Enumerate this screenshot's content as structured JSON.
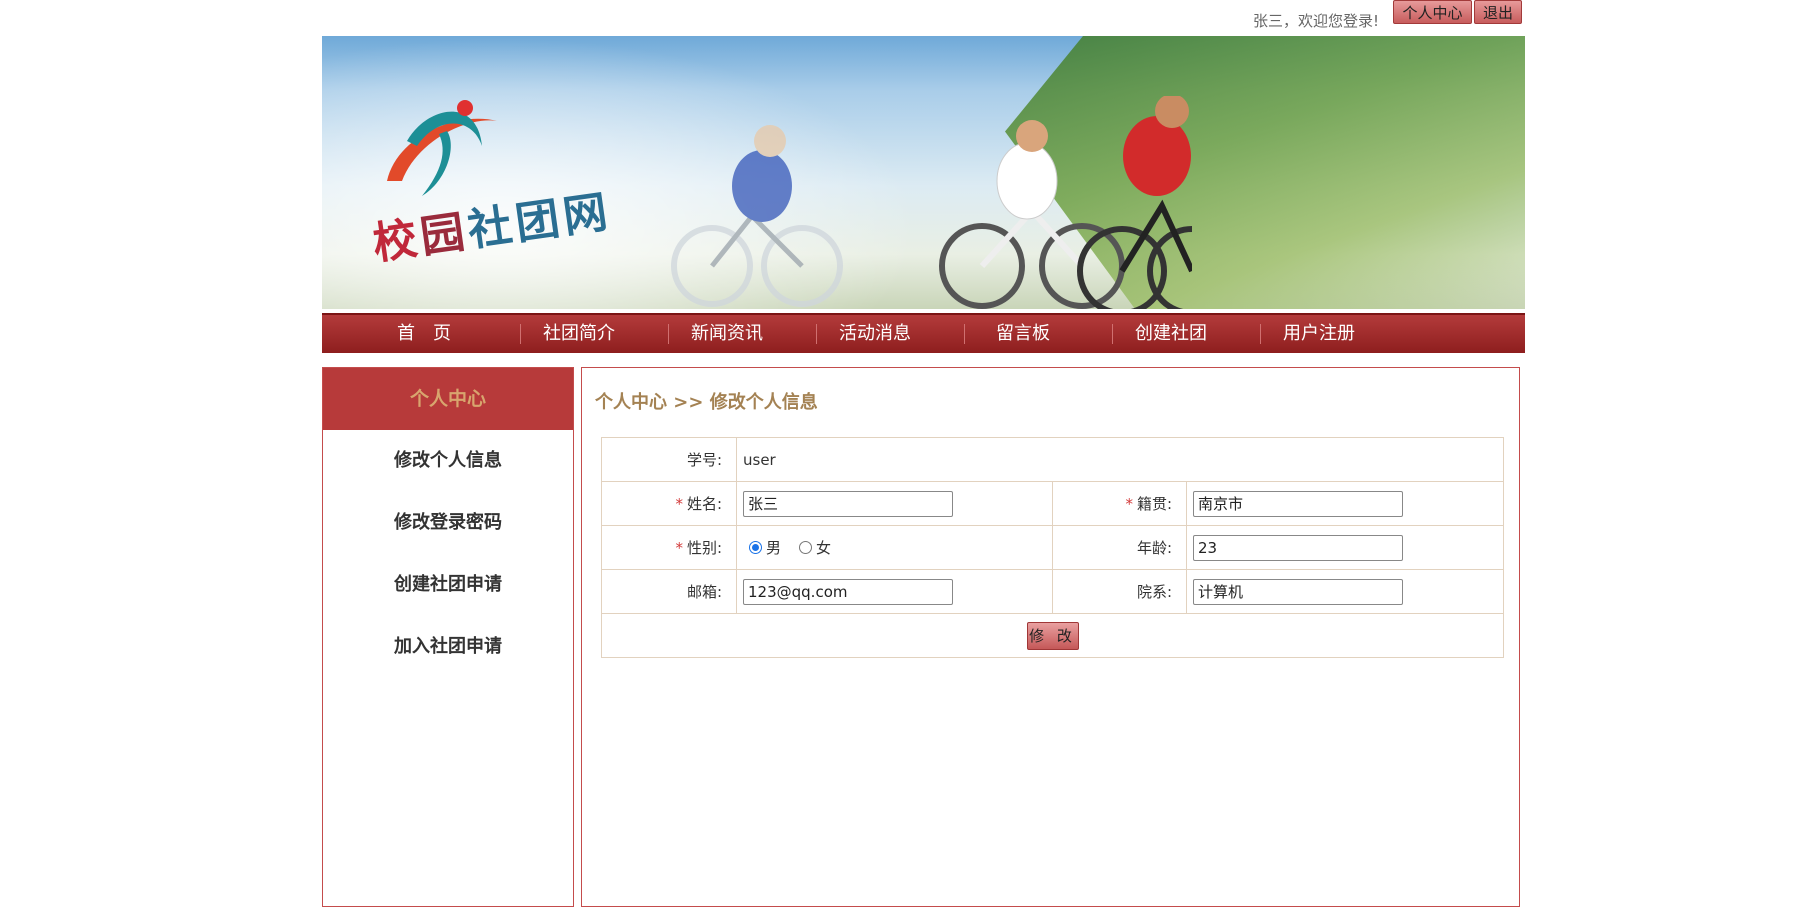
{
  "topbar": {
    "welcome": "张三，欢迎您登录!",
    "personal_center": "个人中心",
    "logout": "退出"
  },
  "banner": {
    "logo_text": [
      "校",
      "园",
      "社",
      "团",
      "网"
    ]
  },
  "nav": {
    "items": [
      "首　页",
      "社团简介",
      "新闻资讯",
      "活动消息",
      "留言板",
      "创建社团",
      "用户注册"
    ]
  },
  "sidebar": {
    "title": "个人中心",
    "items": [
      "修改个人信息",
      "修改登录密码",
      "创建社团申请",
      "加入社团申请"
    ]
  },
  "main": {
    "breadcrumb": "个人中心 >> 修改个人信息",
    "form": {
      "student_id_label": "学号:",
      "student_id_value": "user",
      "name_label": "姓名:",
      "name_value": "张三",
      "hometown_label": "籍贯:",
      "hometown_value": "南京市",
      "gender_label": "性别:",
      "gender_male": "男",
      "gender_female": "女",
      "gender_selected": "男",
      "age_label": "年龄:",
      "age_value": "23",
      "email_label": "邮箱:",
      "email_value": "123@qq.com",
      "department_label": "院系:",
      "department_value": "计算机",
      "submit_label": "修 改"
    }
  },
  "colors": {
    "nav_red": "#9e2a2a",
    "sidebar_title_bg": "#b73a3a",
    "accent_gold": "#a48253",
    "radio_blue": "#1a73e8"
  }
}
